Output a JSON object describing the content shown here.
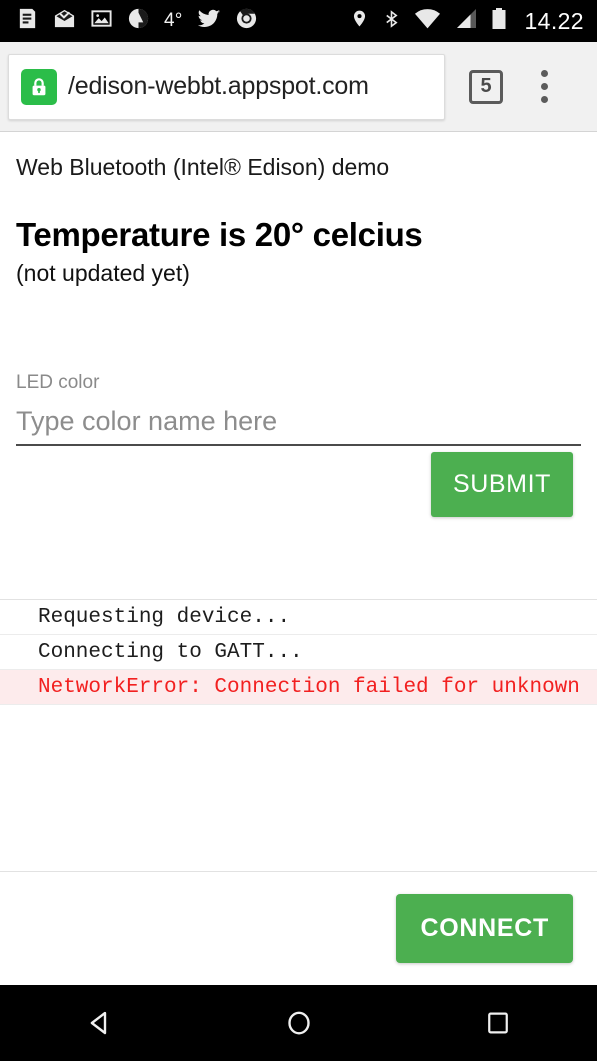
{
  "statusbar": {
    "icons_left": [
      "news-icon",
      "mail-icon",
      "photo-icon",
      "weather-app-icon",
      "twitter-icon",
      "chrome-icon"
    ],
    "temperature": "4°",
    "icons_right": [
      "location-pin-icon",
      "bluetooth-icon",
      "wifi-icon",
      "cellular-signal-icon",
      "battery-icon"
    ],
    "clock": "14.22"
  },
  "browser": {
    "security_icon": "lock-icon",
    "url": "/edison-webbt.appspot.com",
    "tab_count": "5",
    "menu_icon": "overflow-menu-icon"
  },
  "page": {
    "subtitle": "Web Bluetooth (Intel® Edison) demo",
    "temperature_heading": "Temperature is 20° celcius",
    "temperature_note": "(not updated yet)",
    "form": {
      "led_label": "LED color",
      "led_placeholder": "Type color name here",
      "led_value": "",
      "submit_label": "SUBMIT"
    },
    "log": [
      {
        "text": "Requesting device...",
        "level": "info"
      },
      {
        "text": "Connecting to GATT...",
        "level": "info"
      },
      {
        "text": "NetworkError: Connection failed for unknown",
        "level": "error"
      }
    ],
    "connect_label": "CONNECT"
  },
  "navbar": {
    "back": "back-icon",
    "home": "home-icon",
    "recents": "recents-icon"
  },
  "colors": {
    "accent_green": "#4caf50",
    "lock_green": "#2bbd49",
    "error_red": "#f22020",
    "error_bg": "#fdebec",
    "toolbar_bg": "#f1f1f1",
    "statusbar_bg": "#000000"
  }
}
